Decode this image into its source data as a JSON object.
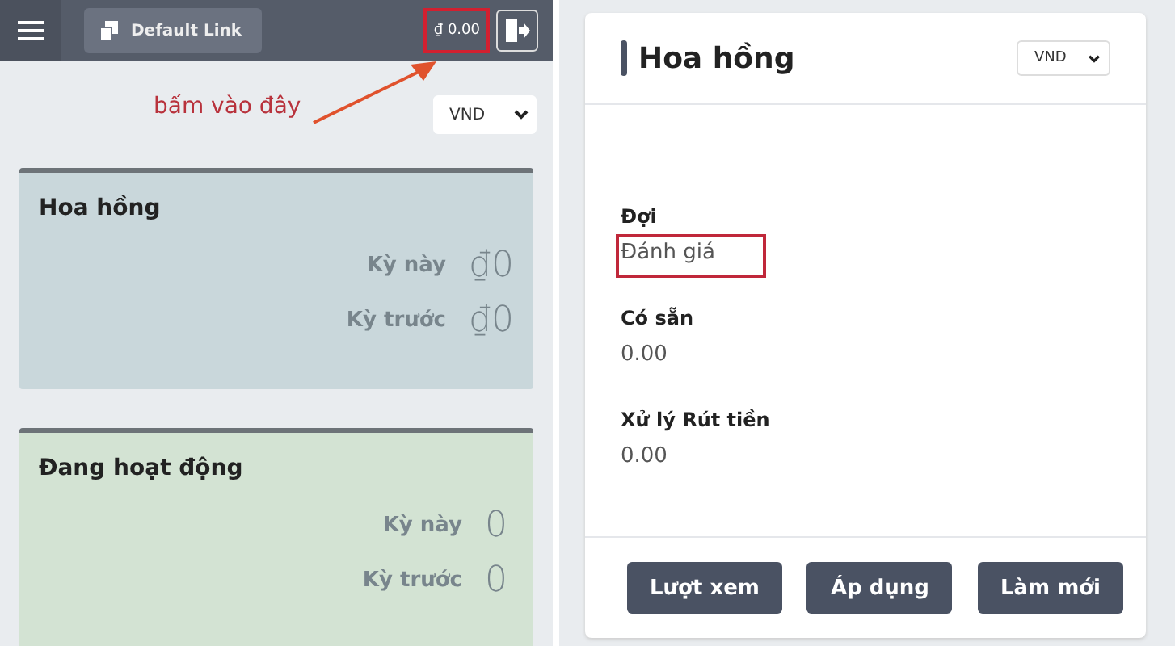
{
  "left_panel": {
    "top_bar": {
      "link_button": "Default Link",
      "balance": {
        "text": "₫ 0.00",
        "highlighted": true
      }
    },
    "annotation": "bấm vào đây",
    "currency_select": "VND",
    "cards": [
      {
        "title": "Hoa hồng",
        "color": "#c9d7db",
        "rows": [
          {
            "label": "Kỳ này",
            "value": "₫0"
          },
          {
            "label": "Kỳ trước",
            "value": "₫0"
          }
        ]
      },
      {
        "title": "Đang hoạt động",
        "color": "#d3e3d3",
        "rows": [
          {
            "label": "Kỳ này",
            "value": "0"
          },
          {
            "label": "Kỳ trước",
            "value": "0"
          }
        ]
      }
    ]
  },
  "right_panel": {
    "title": "Hoa hồng",
    "currency_select": "VND",
    "fields": [
      {
        "label": "Đợi",
        "value": "Đánh giá",
        "highlighted": true
      },
      {
        "label": "Có sẵn",
        "value": "0.00",
        "highlighted": false
      },
      {
        "label": "Xử lý Rút tiền",
        "value": "0.00",
        "highlighted": false
      }
    ],
    "buttons": [
      "Lượt xem",
      "Áp dụng",
      "Làm mới"
    ]
  }
}
